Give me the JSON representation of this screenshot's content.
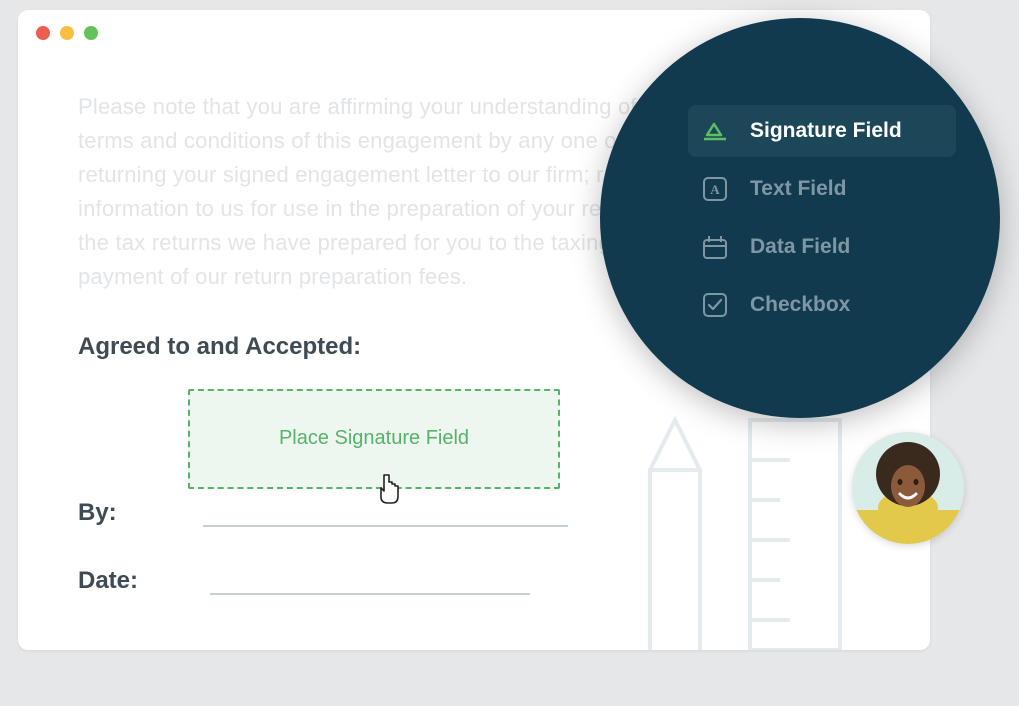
{
  "document": {
    "body_text": "Please note that you are affirming your understanding of, and agreement to, the terms and conditions of this engagement by any one of the following actions: returning your signed engagement letter to our firm; returning your income tax information to us for use in the preparation of your returns; the submission of the tax returns we have prepared for you to the taxing authorities; or the payment of our return preparation fees.",
    "agreed_label": "Agreed to and Accepted:",
    "by_label": "By:",
    "date_label": "Date:",
    "placeholder_label": "Place Signature Field"
  },
  "palette": {
    "items": [
      {
        "label": "Signature Field",
        "icon": "signature-icon",
        "selected": true
      },
      {
        "label": "Text Field",
        "icon": "text-field-icon",
        "selected": false
      },
      {
        "label": "Data Field",
        "icon": "data-field-icon",
        "selected": false
      },
      {
        "label": "Checkbox",
        "icon": "checkbox-icon",
        "selected": false
      }
    ]
  }
}
